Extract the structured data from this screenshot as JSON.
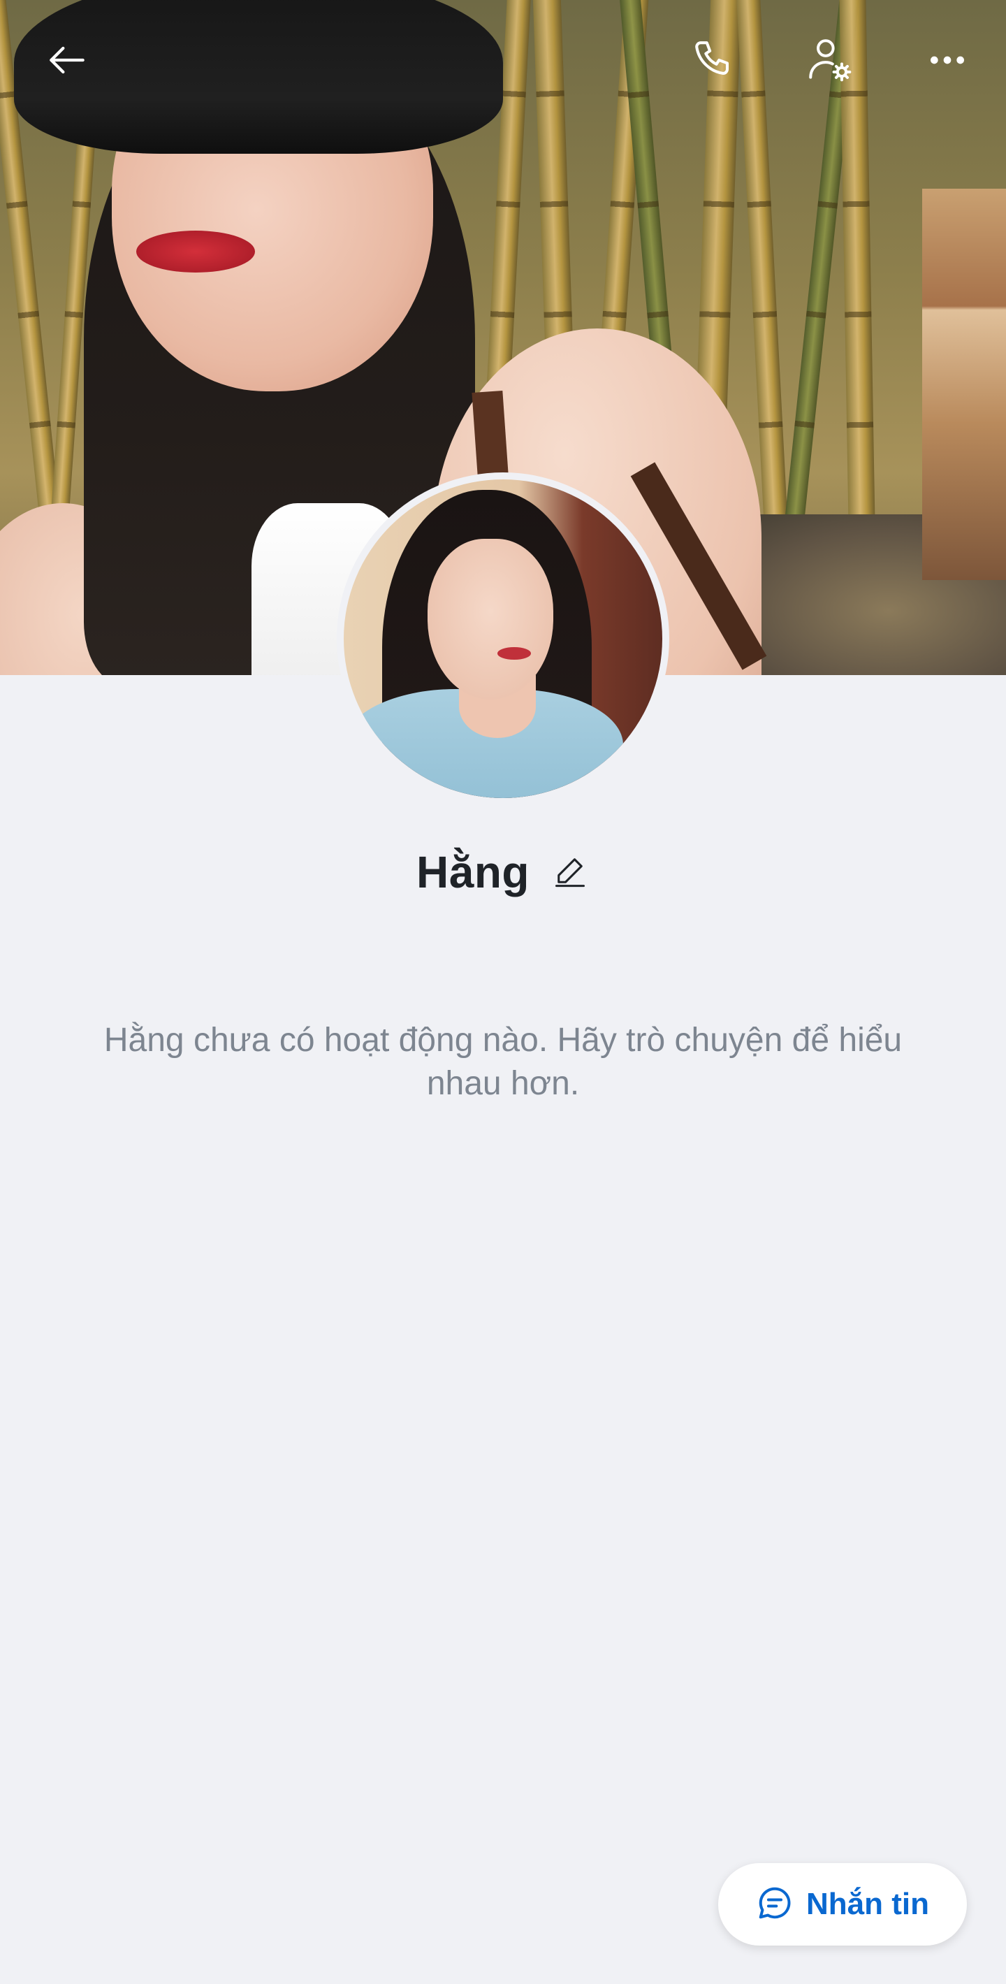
{
  "header": {
    "back_icon": "arrow-left-icon",
    "call_icon": "phone-icon",
    "settings_icon": "user-settings-icon",
    "more_icon": "more-horizontal-icon",
    "icon_color": "#ffffff"
  },
  "profile": {
    "name": "Hằng",
    "edit_icon": "pencil-icon"
  },
  "activity": {
    "empty_message": "Hằng chưa có hoạt động nào. Hãy trò chuyện để hiểu nhau hơn."
  },
  "actions": {
    "message_label": "Nhắn tin",
    "message_icon": "chat-bubble-icon",
    "accent_color": "#0a68d0"
  },
  "theme": {
    "background": "#f0f1f5",
    "name_color": "#1f2328",
    "muted_text": "#7d8590"
  }
}
